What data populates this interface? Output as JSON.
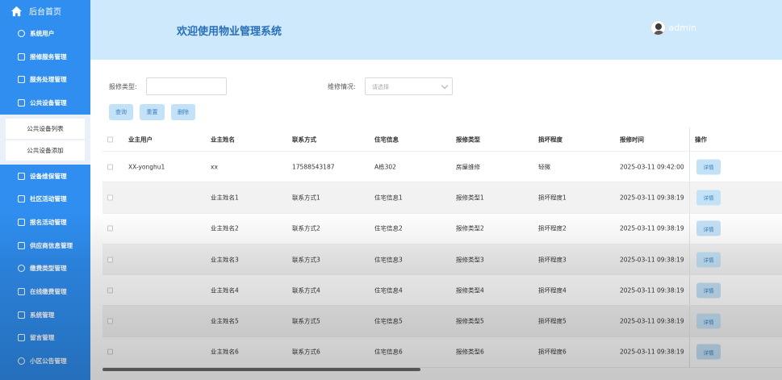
{
  "sidebar": {
    "home_label": "后台首页",
    "items": [
      {
        "label": "系统用户"
      },
      {
        "label": "报修服务管理"
      },
      {
        "label": "服务处理管理"
      },
      {
        "label": "公共设备管理"
      }
    ],
    "subitems": [
      {
        "label": "公共设备列表"
      },
      {
        "label": "公共设备添加"
      }
    ],
    "items_after": [
      {
        "label": "设备维保管理"
      },
      {
        "label": "社区活动管理"
      },
      {
        "label": "报名活动管理"
      },
      {
        "label": "供应商信息管理"
      },
      {
        "label": "缴费类型管理"
      },
      {
        "label": "在线缴费管理"
      },
      {
        "label": "系统管理"
      },
      {
        "label": "留言管理"
      },
      {
        "label": "小区公告管理"
      }
    ]
  },
  "header": {
    "title": "欢迎使用物业管理系统",
    "username": "admin"
  },
  "search": {
    "type_label": "报修类型:",
    "type_value": "",
    "status_label": "维修情况:",
    "status_placeholder": "请选择"
  },
  "buttons": {
    "query": "查询",
    "reset": "重置",
    "delete": "删除"
  },
  "table": {
    "columns": [
      "业主用户",
      "业主姓名",
      "联系方式",
      "住宅信息",
      "报修类型",
      "损坏程度",
      "报修时间",
      "操作"
    ],
    "detail_label": "详情",
    "rows": [
      [
        "XX-yonghu1",
        "xx",
        "17588543187",
        "A栋302",
        "房屋维修",
        "轻微",
        "2025-03-11 09:42:00"
      ],
      [
        "",
        "业主姓名1",
        "联系方式1",
        "住宅信息1",
        "报修类型1",
        "损坏程度1",
        "2025-03-11 09:38:19"
      ],
      [
        "",
        "业主姓名2",
        "联系方式2",
        "住宅信息2",
        "报修类型2",
        "损坏程度2",
        "2025-03-11 09:38:19"
      ],
      [
        "",
        "业主姓名3",
        "联系方式3",
        "住宅信息3",
        "报修类型3",
        "损坏程度3",
        "2025-03-11 09:38:19"
      ],
      [
        "",
        "业主姓名4",
        "联系方式4",
        "住宅信息4",
        "报修类型4",
        "损坏程度4",
        "2025-03-11 09:38:19"
      ],
      [
        "",
        "业主姓名5",
        "联系方式5",
        "住宅信息5",
        "报修类型5",
        "损坏程度5",
        "2025-03-11 09:38:19"
      ],
      [
        "",
        "业主姓名6",
        "联系方式6",
        "住宅信息6",
        "报修类型6",
        "损坏程度6",
        "2025-03-11 09:38:19"
      ]
    ]
  },
  "colors": {
    "sidebar": "#2f8ef0",
    "header": "#cde9fb",
    "title": "#2a6fb8",
    "button": "#c4e2f7"
  }
}
